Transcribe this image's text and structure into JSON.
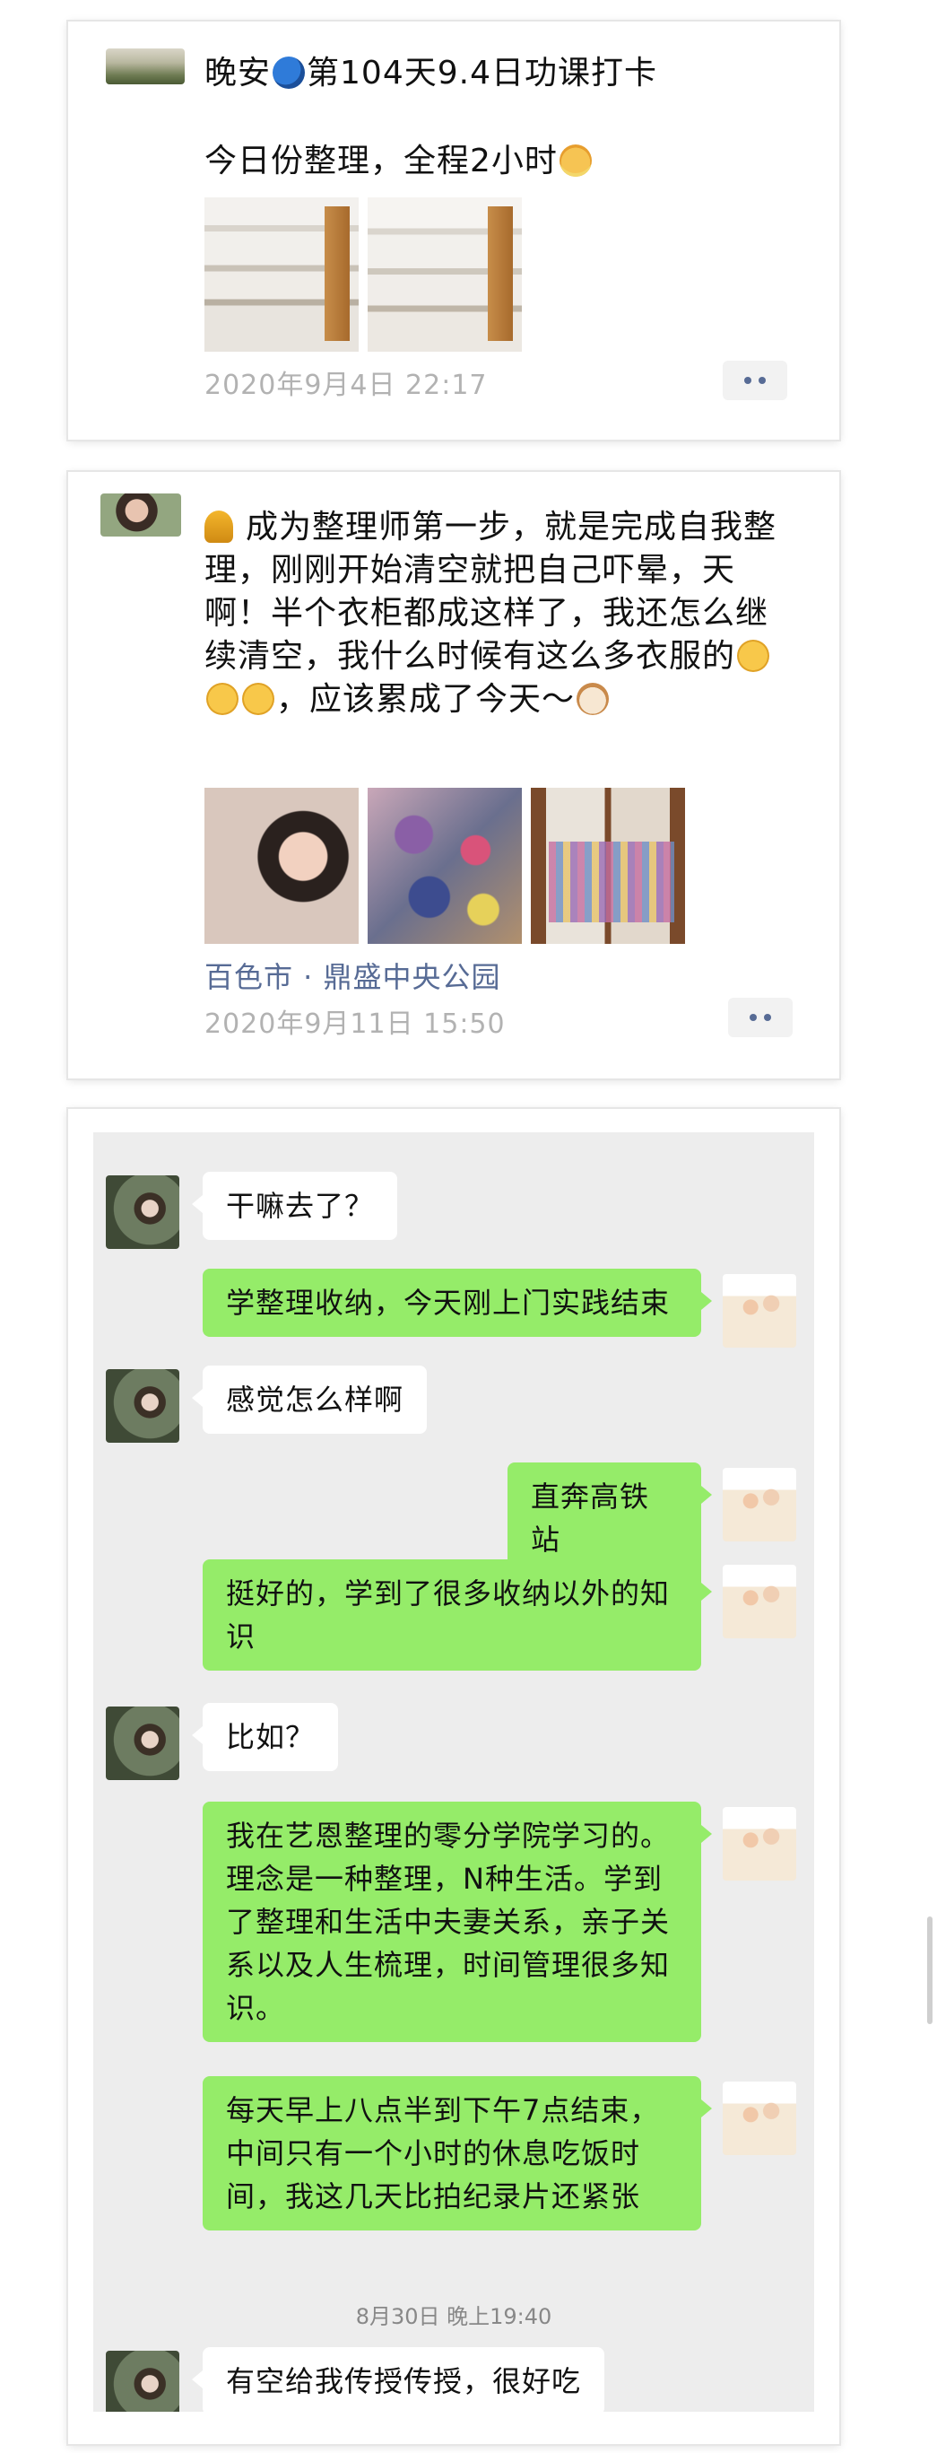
{
  "posts": [
    {
      "line1_a": "晚安",
      "line1_b": "第104天9.4日功课打卡",
      "line2": "今日份整理，全程2小时",
      "timestamp": "2020年9月4日 22:17"
    },
    {
      "text": "成为整理师第一步，就是完成自我整理，刚刚开始清空就把自己吓晕，天啊！半个衣柜都成这样了，我还怎么继续清空，我什么时候有这么多衣服的",
      "text_tail": "，应该累成了今天～",
      "location": "百色市 · 鼎盛中央公园",
      "timestamp": "2020年9月11日 15:50"
    }
  ],
  "chat": {
    "messages": [
      {
        "side": "left",
        "text": "干嘛去了？"
      },
      {
        "side": "right",
        "text": "学整理收纳，今天刚上门实践结束"
      },
      {
        "side": "left",
        "text": "感觉怎么样啊"
      },
      {
        "side": "right",
        "text": "直奔高铁站"
      },
      {
        "side": "right",
        "text": "挺好的，学到了很多收纳以外的知识"
      },
      {
        "side": "left",
        "text": "比如？"
      },
      {
        "side": "right",
        "text": "我在艺恩整理的零分学院学习的。理念是一种整理，N种生活。学到了整理和生活中夫妻关系，亲子关系以及人生梳理，时间管理很多知识。"
      },
      {
        "side": "right",
        "text": "每天早上八点半到下午7点结束，中间只有一个小时的休息吃饭时间，我这几天比拍纪录片还紧张"
      },
      {
        "side": "left",
        "text": "有空给我传授传授，很好吃"
      }
    ],
    "time_divider": "8月30日 晚上19:40"
  },
  "icons": {
    "more": "more-dots-icon",
    "bell": "bell-emoji",
    "moon": "moon-emoji",
    "angel": "angel-face-emoji",
    "cry": "crying-laugh-emoji",
    "dog": "dog-face-emoji"
  },
  "colors": {
    "link": "#576b95",
    "bubble_self": "#95ec69",
    "chat_bg": "#ededed",
    "meta_text": "#b2b2b2"
  }
}
